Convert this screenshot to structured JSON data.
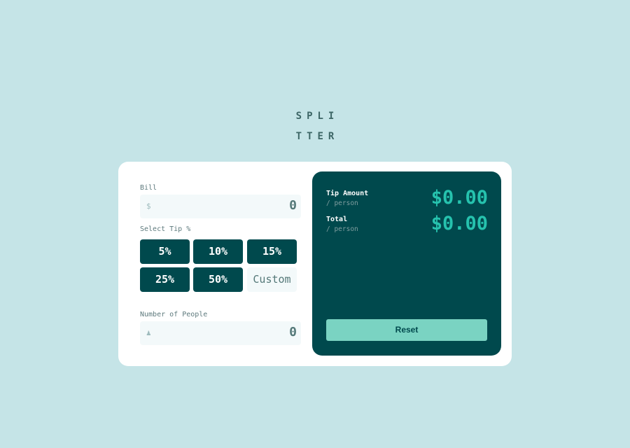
{
  "app": {
    "logo_line1": "SPLI",
    "logo_line2": "TTER"
  },
  "bill": {
    "label": "Bill",
    "icon": "dollar-icon",
    "icon_glyph": "$",
    "value": "0"
  },
  "tip": {
    "label": "Select Tip %",
    "options": [
      "5%",
      "10%",
      "15%",
      "25%",
      "50%"
    ],
    "custom_placeholder": "Custom"
  },
  "people": {
    "label": "Number of People",
    "icon": "person-icon",
    "icon_glyph": "♟",
    "value": "0"
  },
  "results": {
    "tip_amount_label": "Tip Amount",
    "tip_amount_sub": "/ person",
    "tip_amount_value": "$0.00",
    "total_label": "Total",
    "total_sub": "/ person",
    "total_value": "$0.00",
    "reset_label": "Reset"
  },
  "colors": {
    "background": "#c5e4e7",
    "dark_cyan": "#00494d",
    "strong_cyan": "#26c2ae",
    "reset_button": "#7ad3c2"
  }
}
